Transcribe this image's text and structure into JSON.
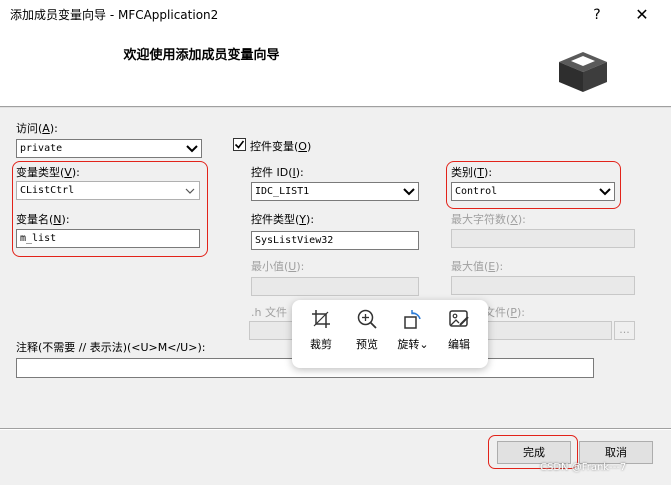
{
  "window": {
    "title": "添加成员变量向导 - MFCApplication2",
    "help": "?",
    "close": "✕"
  },
  "header": {
    "title": "欢迎使用添加成员变量向导"
  },
  "form": {
    "access": {
      "label": "访问",
      "hotkey": "A",
      "label_tail": "):",
      "label_head": "(",
      "value": "private"
    },
    "control_var": {
      "label": "控件变量(",
      "hotkey": "O",
      "label_tail": ")",
      "checked": true
    },
    "var_type": {
      "label": "变量类型(",
      "hotkey": "V",
      "label_tail": "):",
      "value": "CListCtrl"
    },
    "control_id": {
      "label": "控件 ID(",
      "hotkey": "I",
      "label_tail": "):",
      "value": "IDC_LIST1"
    },
    "category": {
      "label": "类别(",
      "hotkey": "T",
      "label_tail": "):",
      "value": "Control"
    },
    "var_name": {
      "label": "变量名(",
      "hotkey": "N",
      "label_tail": "):",
      "value": "m_list"
    },
    "control_type": {
      "label": "控件类型(",
      "hotkey": "Y",
      "label_tail": "):",
      "value": "SysListView32"
    },
    "max_chars": {
      "label": "最大字符数(",
      "hotkey": "X",
      "label_tail": "):"
    },
    "min_value": {
      "label": "最小值(",
      "hotkey": "U",
      "label_tail": "):"
    },
    "max_value": {
      "label": "最大值(",
      "hotkey": "E",
      "label_tail": "):"
    },
    "h_file": {
      "label": ".h 文件"
    },
    "cpp_file": {
      "label": "文件(",
      "hotkey": "P",
      "label_tail": "):"
    },
    "browse": "...",
    "comment": {
      "label": "注释(不需要 // 表示法)(<U>M</U>):",
      "value": ""
    }
  },
  "popup": {
    "items": [
      {
        "label": "裁剪",
        "icon": "crop-icon"
      },
      {
        "label": "预览",
        "icon": "zoom-icon"
      },
      {
        "label": "旋转",
        "icon": "rotate-icon",
        "caret": "⌄"
      },
      {
        "label": "编辑",
        "icon": "edit-image-icon"
      }
    ]
  },
  "footer": {
    "finish": "完成",
    "cancel": "取消"
  },
  "watermark": "CSDN @Frank---7",
  "colors": {
    "highlight": "#e2231a",
    "dialog_bg": "#f0f0f0"
  }
}
